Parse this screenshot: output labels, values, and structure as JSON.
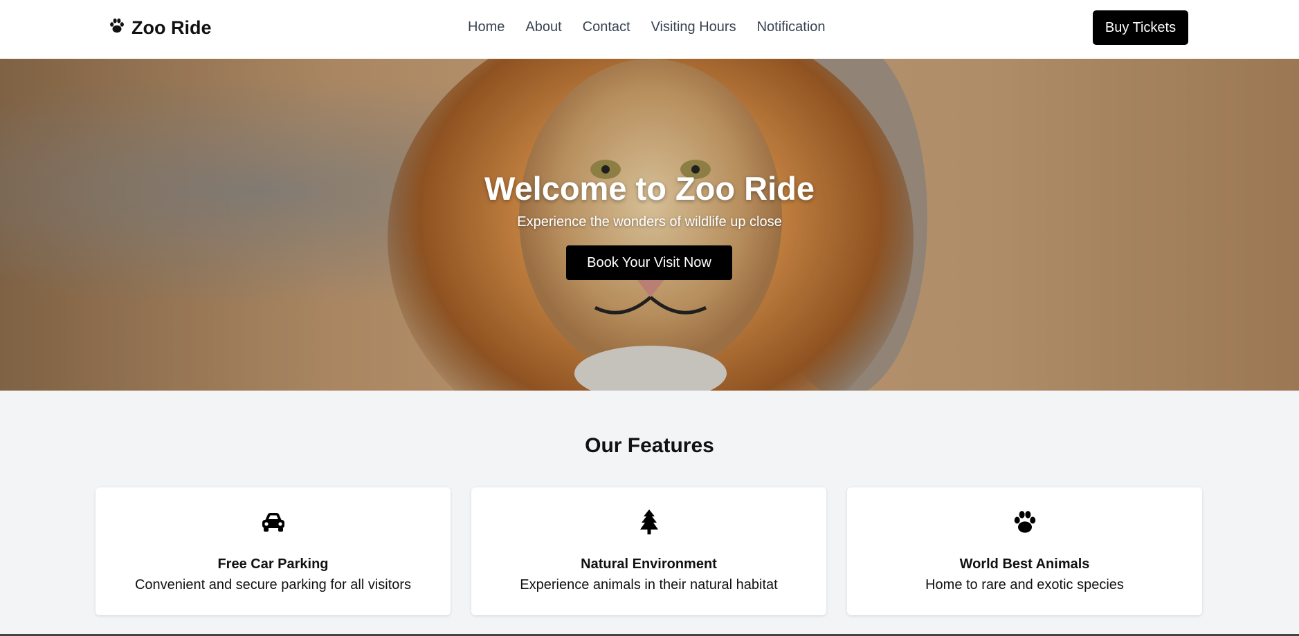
{
  "brand": {
    "name": "Zoo Ride",
    "icon": "paw-icon"
  },
  "nav": {
    "items": [
      {
        "label": "Home"
      },
      {
        "label": "About"
      },
      {
        "label": "Contact"
      },
      {
        "label": "Visiting Hours"
      },
      {
        "label": "Notification"
      }
    ]
  },
  "header": {
    "cta_label": "Buy Tickets"
  },
  "hero": {
    "title": "Welcome to Zoo Ride",
    "subtitle": "Experience the wonders of wildlife up close",
    "cta_label": "Book Your Visit Now"
  },
  "features": {
    "title": "Our Features",
    "cards": [
      {
        "icon": "car-icon",
        "title": "Free Car Parking",
        "desc": "Convenient and secure parking for all visitors"
      },
      {
        "icon": "tree-icon",
        "title": "Natural Environment",
        "desc": "Experience animals in their natural habitat"
      },
      {
        "icon": "paw-icon",
        "title": "World Best Animals",
        "desc": "Home to rare and exotic species"
      }
    ]
  },
  "colors": {
    "primary": "#000000",
    "background": "#f3f4f6",
    "nav_text": "#374151"
  }
}
